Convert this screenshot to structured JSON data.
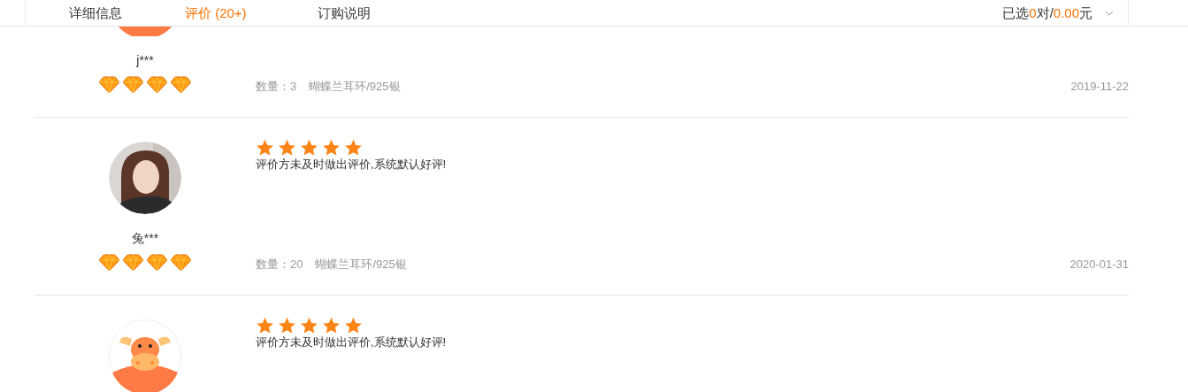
{
  "tabs": [
    {
      "label": "详细信息",
      "selected": false
    },
    {
      "label": "评价 (20+)",
      "selected": true
    },
    {
      "label": "订购说明",
      "selected": false
    }
  ],
  "cart_summary": {
    "prefix": "已选",
    "count": "0",
    "unit": "对",
    "separator": "/",
    "amount": "0.00",
    "currency": "元"
  },
  "reviews": [
    {
      "avatar": {
        "kind": "mascot"
      },
      "buyer": {
        "name": "j***",
        "stars": 4
      },
      "quantity_label": "数量：",
      "quantity": "3",
      "variant": "蝴蝶兰耳环/925银",
      "date": "2019-11-22"
    },
    {
      "buyer": {
        "name": "兔***",
        "stars": 4
      },
      "rating": {
        "stars": 5
      },
      "comment": "评价方未及时做出评价,系统默认好评!",
      "quantity_label": "数量：",
      "quantity": "20",
      "variant": "蝴蝶兰耳环/925银",
      "date": "2020-01-31"
    },
    {
      "avatar": {
        "kind": "mascot"
      },
      "rating": {
        "stars": 5
      },
      "comment": "评价方未及时做出评价,系统默认好评!"
    }
  ]
}
